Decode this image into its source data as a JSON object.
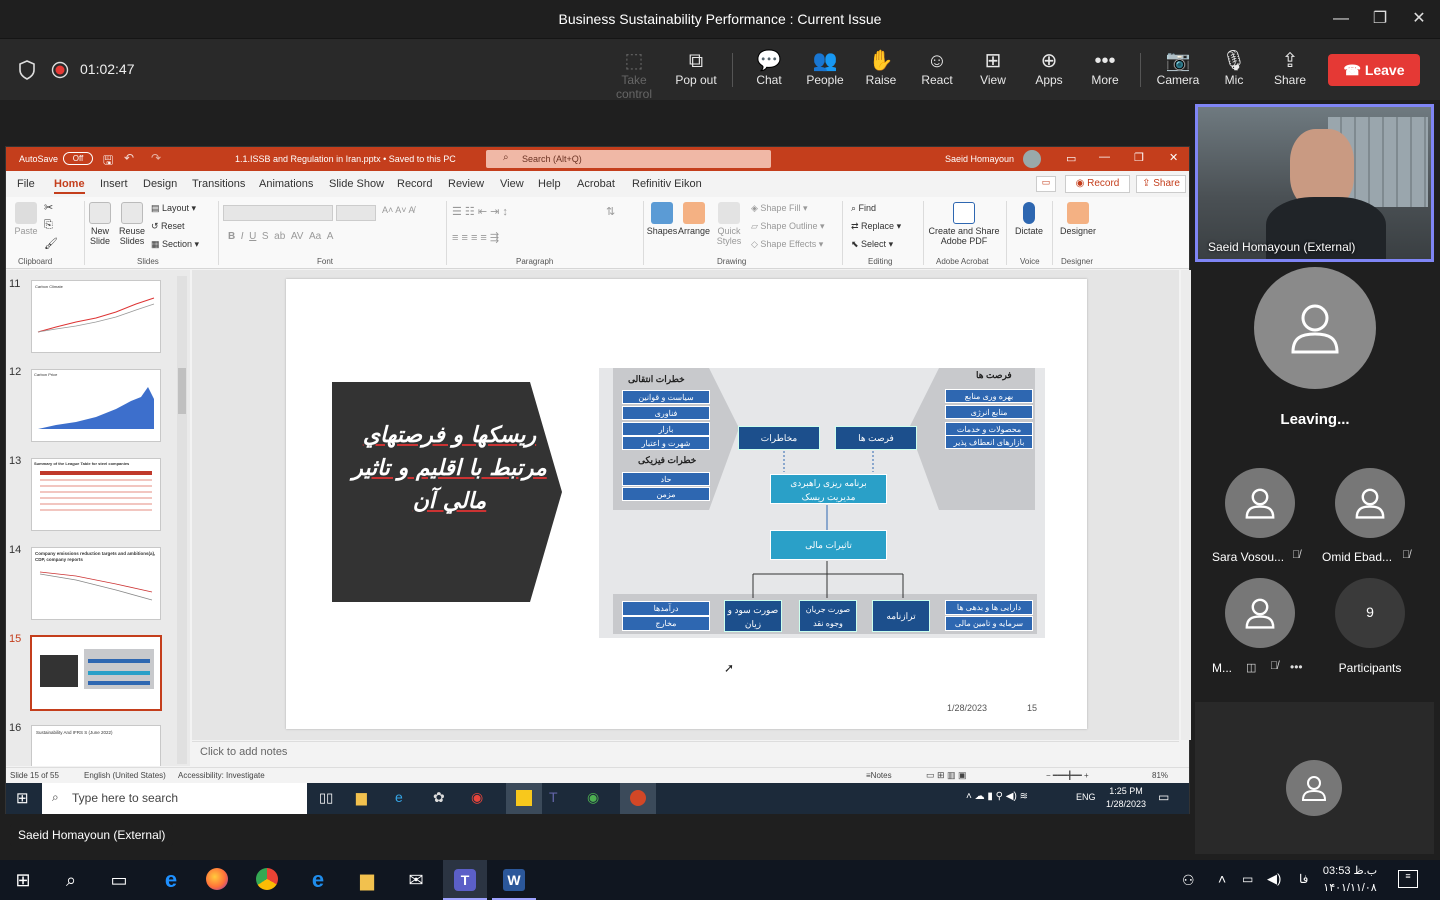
{
  "window": {
    "title": "Business Sustainability Performance : Current Issue",
    "minimize": "—",
    "restore": "❐",
    "close": "✕"
  },
  "meeting": {
    "timer": "01:02:47",
    "toolbar": [
      {
        "label": "Take control",
        "icon": "⬚",
        "disabled": true
      },
      {
        "label": "Pop out",
        "icon": "⧉"
      },
      {
        "label": "Chat",
        "icon": "💬"
      },
      {
        "label": "People",
        "icon": "👥"
      },
      {
        "label": "Raise",
        "icon": "✋"
      },
      {
        "label": "React",
        "icon": "☺"
      },
      {
        "label": "View",
        "icon": "⊞"
      },
      {
        "label": "Apps",
        "icon": "⊕"
      },
      {
        "label": "More",
        "icon": "•••"
      },
      {
        "label": "Camera",
        "icon": "📷"
      },
      {
        "label": "Mic",
        "icon": "🎙"
      },
      {
        "label": "Share",
        "icon": "⇪"
      }
    ],
    "leave_label": "Leave",
    "presenter_label": "Saeid Homayoun (External)"
  },
  "ppt": {
    "autosave": "AutoSave",
    "autosave_state": "Off",
    "filename": "1.1.ISSB and Regulation in Iran.pptx • Saved to this PC",
    "search_placeholder": "Search (Alt+Q)",
    "user": "Saeid Homayoun",
    "tabs": [
      "File",
      "Home",
      "Insert",
      "Design",
      "Transitions",
      "Animations",
      "Slide Show",
      "Record",
      "Review",
      "View",
      "Help",
      "Acrobat",
      "Refinitiv Eikon"
    ],
    "record_btn": "Record",
    "share_btn": "Share",
    "ribbon": {
      "paste": "Paste",
      "new_slide": "New Slide",
      "reuse_slides": "Reuse Slides",
      "layout": "Layout",
      "reset": "Reset",
      "section": "Section",
      "shapes": "Shapes",
      "arrange": "Arrange",
      "quick_styles": "Quick Styles",
      "shape_fill": "Shape Fill",
      "shape_outline": "Shape Outline",
      "shape_effects": "Shape Effects",
      "find": "Find",
      "replace": "Replace",
      "select": "Select",
      "create_share": "Create and Share Adobe PDF",
      "dictate": "Dictate",
      "designer": "Designer",
      "groups": [
        "Clipboard",
        "Slides",
        "Font",
        "Paragraph",
        "Drawing",
        "Editing",
        "Adobe Acrobat",
        "Voice",
        "Designer"
      ]
    },
    "thumbnails": [
      {
        "num": "11",
        "caption": "Carbon Climate"
      },
      {
        "num": "12",
        "caption": "Carbon Price"
      },
      {
        "num": "13",
        "caption": "Summary of the League Table for steel companies"
      },
      {
        "num": "14",
        "caption": "Company emissions reduction targets and ambitions(a), CDP, company reports"
      },
      {
        "num": "15",
        "caption": ""
      },
      {
        "num": "16",
        "caption": "Sustainability And IFRS S (June 2022)"
      }
    ],
    "notes_placeholder": "Click to add notes",
    "status": {
      "slide": "Slide 15 of 55",
      "language": "English (United States)",
      "accessibility": "Accessibility: Investigate",
      "notes": "Notes",
      "zoom": "81%"
    },
    "slide": {
      "title_text": "ریسکها و فرصتهاي مرتبط با اقليم و تاثير مالي آن",
      "date": "1/28/2023",
      "page": "15",
      "left_header_transition": "خطرات انتقالی",
      "transition_items": [
        "سیاست و قوانین",
        "فناوری",
        "بازار",
        "شهرت و اعتبار"
      ],
      "left_header_physical": "خطرات فیزیکی",
      "physical_items": [
        "حاد",
        "مزمن"
      ],
      "right_header": "فرصت ها",
      "opportunity_items": [
        "بهره وری منابع",
        "منابع انرژی",
        "محصولات و خدمات",
        "بازارهای انعطاف پذیر"
      ],
      "risks_box": "مخاطرات",
      "opps_box": "فرصت ها",
      "strategy_box": "برنامه ریزی راهبردی مدیریت ریسک",
      "financial_box": "تاثیرات مالی",
      "bottom_left": [
        "درآمدها",
        "مخارج"
      ],
      "income_statement": "صورت سود و زیان",
      "cashflow": "صورت جریان وجوه نقد",
      "balance_sheet": "ترازنامه",
      "bottom_right": [
        "دارایی ها و بدهی ها",
        "سرمایه و تامین مالی"
      ]
    },
    "taskbar": {
      "search_placeholder": "Type here to search",
      "time": "1:25 PM",
      "date": "1/28/2023",
      "lang": "ENG"
    }
  },
  "participants": {
    "leaving": "Leaving...",
    "people": [
      {
        "name": "Sara Vosou..."
      },
      {
        "name": "Omid Ebad..."
      },
      {
        "name": "M..."
      }
    ],
    "count": "9",
    "count_label": "Participants"
  },
  "taskbar": {
    "time": "03:53 ب.ظ",
    "date": "۱۴۰۱/۱۱/۰۸",
    "lang": "فا"
  },
  "colors": {
    "accent_ppt": "#c43e1c",
    "leave_red": "#e53935",
    "teams_purple": "#7f85f5"
  }
}
